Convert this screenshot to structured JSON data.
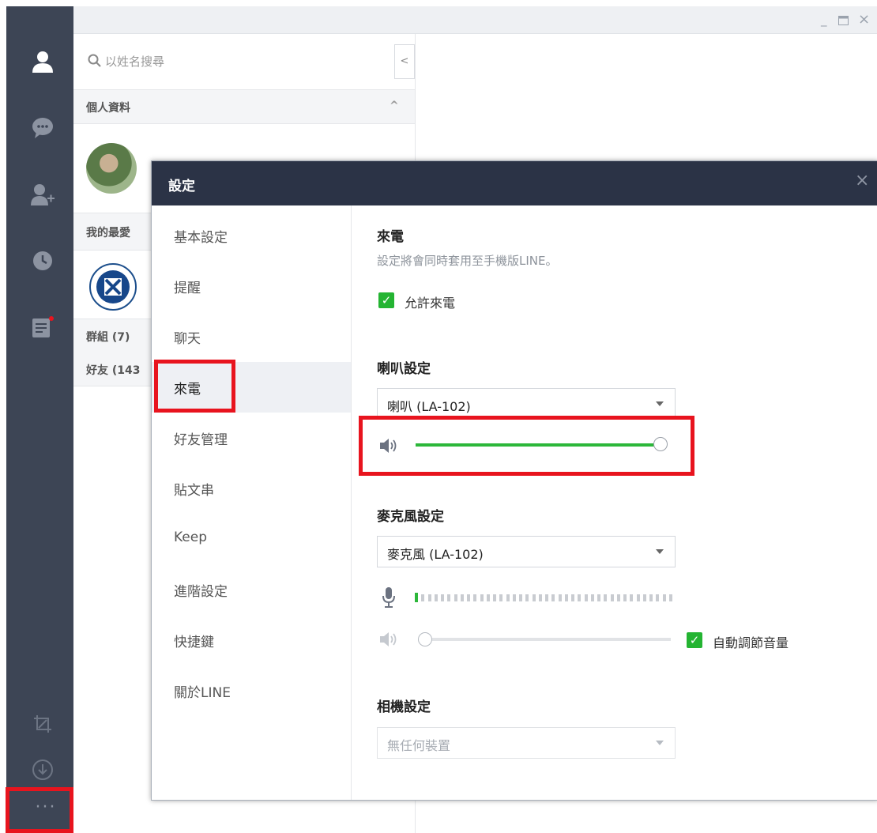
{
  "search": {
    "placeholder": "以姓名搜尋"
  },
  "list": {
    "sections": {
      "profile": "個人資料",
      "favorites": "我的最愛",
      "groups": "群組 (7)",
      "friends": "好友 (143"
    }
  },
  "dialog": {
    "title": "設定",
    "nav": [
      {
        "label": "基本設定"
      },
      {
        "label": "提醒"
      },
      {
        "label": "聊天"
      },
      {
        "label": "來電"
      },
      {
        "label": "好友管理"
      },
      {
        "label": "貼文串"
      },
      {
        "label": "Keep"
      },
      {
        "label": "進階設定"
      },
      {
        "label": "快捷鍵"
      },
      {
        "label": "關於LINE"
      }
    ],
    "active_nav": "來電",
    "calls": {
      "heading": "來電",
      "description": "設定將會同時套用至手機版LINE。",
      "allow_calls_label": "允許來電",
      "allow_calls_checked": true
    },
    "speaker": {
      "heading": "喇叭設定",
      "device": "喇叭 (LA-102)",
      "volume_fraction": 1.0
    },
    "microphone": {
      "heading": "麥克風設定",
      "device": "麥克風 (LA-102)",
      "input_level_fraction": 0.03,
      "volume_fraction": 0.0,
      "auto_adjust_label": "自動調節音量",
      "auto_adjust_checked": true
    },
    "camera": {
      "heading": "相機設定",
      "device": "無任何裝置"
    }
  },
  "colors": {
    "accent_green": "#24b432",
    "highlight_red": "#e8141e",
    "rail_bg": "#3d4555",
    "dialog_title_bg": "#2b3346"
  }
}
